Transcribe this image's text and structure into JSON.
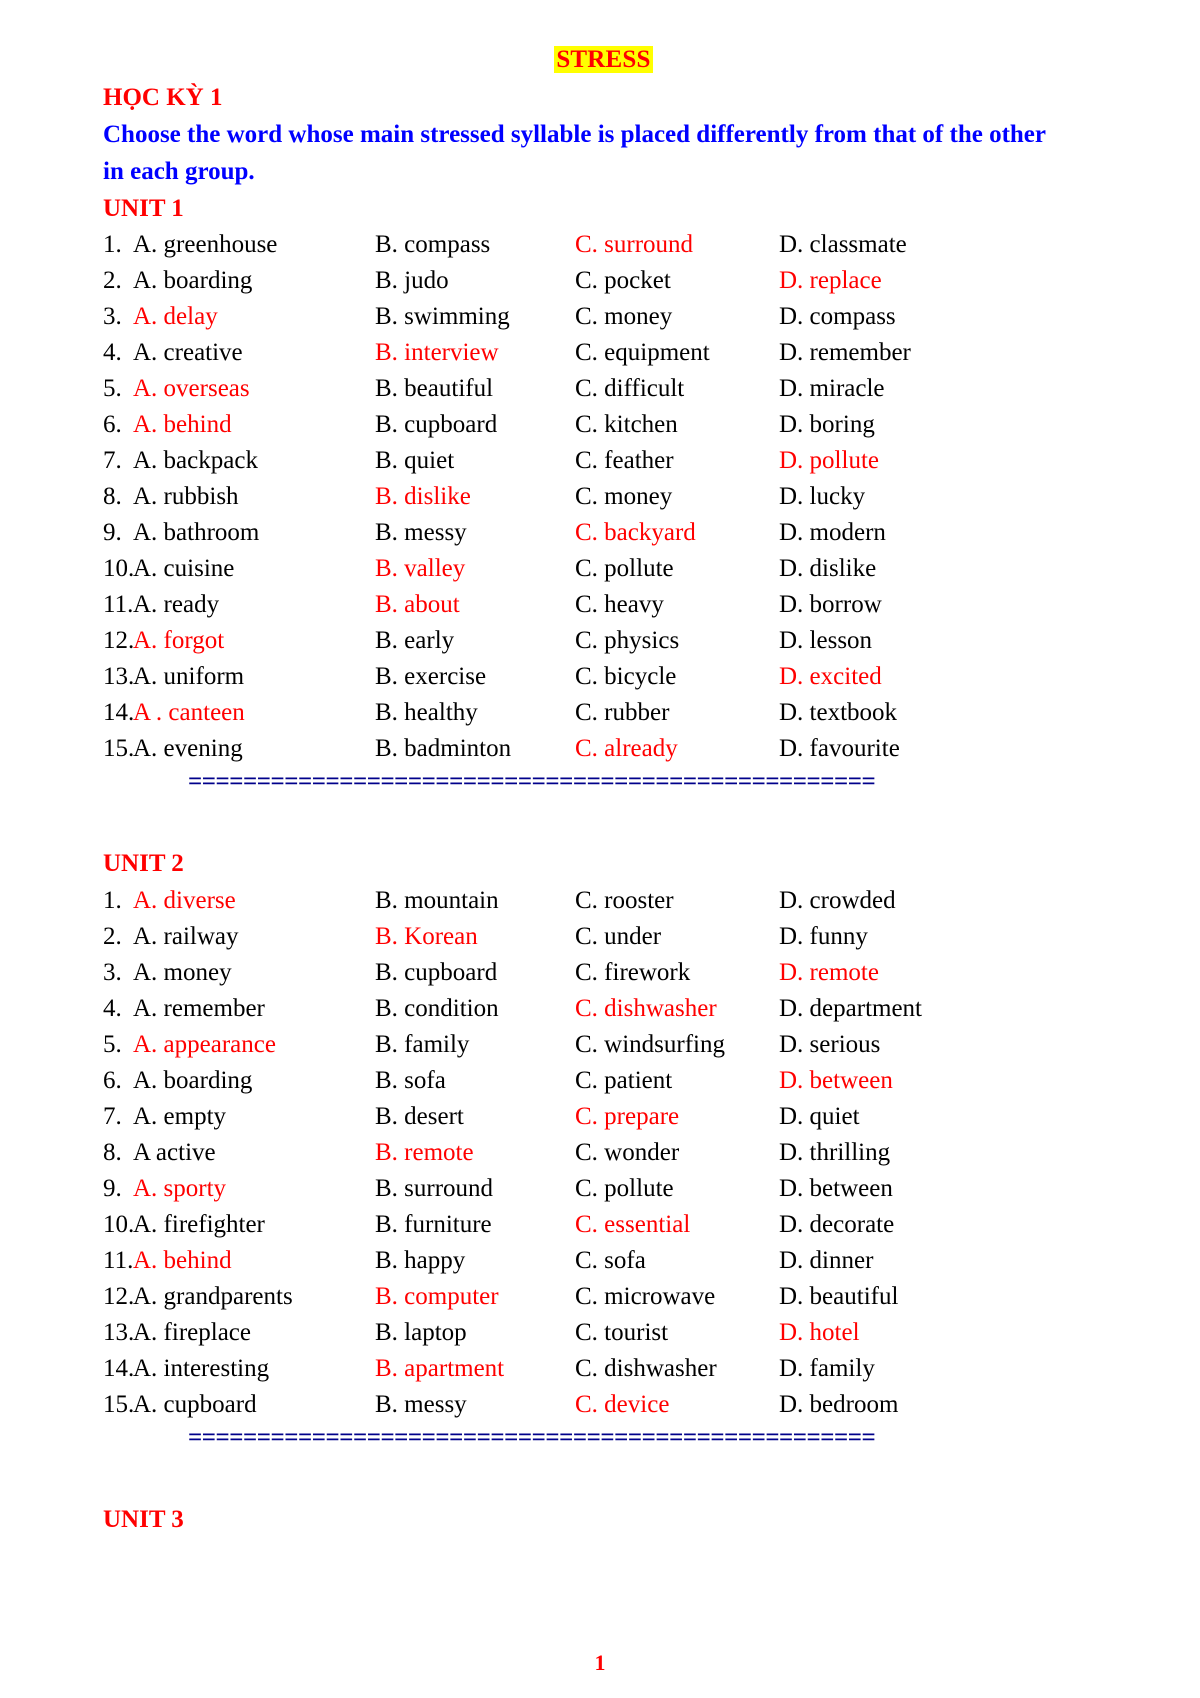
{
  "document": {
    "title": "STRESS",
    "title_highlight_color": "#ffff00",
    "title_text_color": "#ff0000",
    "term_heading": "HỌC KỲ 1",
    "instruction": "Choose the word whose main stressed syllable is placed differently from that of the other in each group.",
    "heading_color": "#ff0000",
    "instruction_color": "#0000ff",
    "answer_color": "#ff0000",
    "separator_color": "#00008b",
    "separator": "==================================================",
    "page_number": "1"
  },
  "units": [
    {
      "heading": "UNIT 1",
      "questions": [
        {
          "num": "1.",
          "a": "A. greenhouse",
          "b": "B. compass",
          "c": "C. surround",
          "d": "D. classmate",
          "answer": "c"
        },
        {
          "num": "2.",
          "a": "A. boarding",
          "b": "B. judo",
          "c": "C. pocket",
          "d": "D. replace",
          "answer": "d"
        },
        {
          "num": "3.",
          "a": "A. delay",
          "b": "B. swimming",
          "c": "C. money",
          "d": "D. compass",
          "answer": "a"
        },
        {
          "num": "4.",
          "a": "A. creative",
          "b": "B. interview",
          "c": "C. equipment",
          "d": "D. remember",
          "answer": "b"
        },
        {
          "num": "5.",
          "a": "A. overseas",
          "b": "B. beautiful",
          "c": "C. difficult",
          "d": "D. miracle",
          "answer": "a"
        },
        {
          "num": "6.",
          "a": "A. behind",
          "b": "B. cupboard",
          "c": "C. kitchen",
          "d": "D. boring",
          "answer": "a"
        },
        {
          "num": "7.",
          "a": "A. backpack",
          "b": "B. quiet",
          "c": "C. feather",
          "d": "D. pollute",
          "answer": "d"
        },
        {
          "num": "8.",
          "a": "A. rubbish",
          "b": "B. dislike",
          "c": "C. money",
          "d": "D. lucky",
          "answer": "b"
        },
        {
          "num": "9.",
          "a": "A. bathroom",
          "b": "B. messy",
          "c": "C. backyard",
          "d": "D. modern",
          "answer": "c"
        },
        {
          "num": "10.",
          "a": "A. cuisine",
          "b": "B. valley",
          "c": "C. pollute",
          "d": "D. dislike",
          "answer": "b"
        },
        {
          "num": "11.",
          "a": "A. ready",
          "b": "B. about",
          "c": "C. heavy",
          "d": "D. borrow",
          "answer": "b"
        },
        {
          "num": "12.",
          "a": "A. forgot",
          "b": "B. early",
          "c": "C. physics",
          "d": "D. lesson",
          "answer": "a"
        },
        {
          "num": "13.",
          "a": "A. uniform",
          "b": "B. exercise",
          "c": "C. bicycle",
          "d": "D. excited",
          "answer": "d"
        },
        {
          "num": "14.",
          "a": "A . canteen",
          "b": "B. healthy",
          "c": "C. rubber",
          "d": "D. textbook",
          "answer": "a"
        },
        {
          "num": "15.",
          "a": "A. evening",
          "b": "B. badminton",
          "c": "C. already",
          "d": "D. favourite",
          "answer": "c"
        }
      ]
    },
    {
      "heading": "UNIT 2",
      "questions": [
        {
          "num": "1.",
          "a": "A. diverse",
          "b": "B. mountain",
          "c": "C. rooster",
          "d": "D. crowded",
          "answer": "a"
        },
        {
          "num": "2.",
          "a": "A. railway",
          "b": "B. Korean",
          "c": "C. under",
          "d": "D. funny",
          "answer": "b"
        },
        {
          "num": "3.",
          "a": "A. money",
          "b": "B. cupboard",
          "c": "C. firework",
          "d": "D. remote",
          "answer": "d"
        },
        {
          "num": "4.",
          "a": "A. remember",
          "b": "B. condition",
          "c": "C. dishwasher",
          "d": "D. department",
          "answer": "c"
        },
        {
          "num": "5.",
          "a": "A. appearance",
          "b": "B. family",
          "c": "C. windsurfing",
          "d": "D. serious",
          "answer": "a"
        },
        {
          "num": "6.",
          "a": "A. boarding",
          "b": "B. sofa",
          "c": "C. patient",
          "d": "D. between",
          "answer": "d"
        },
        {
          "num": "7.",
          "a": "A. empty",
          "b": "B. desert",
          "c": "C. prepare",
          "d": "D. quiet",
          "answer": "c"
        },
        {
          "num": "8.",
          "a": "A active",
          "b": "B. remote",
          "c": "C. wonder",
          "d": "D. thrilling",
          "answer": "b"
        },
        {
          "num": "9.",
          "a": "A. sporty",
          "b": "B. surround",
          "c": "C. pollute",
          "d": "D. between",
          "answer": "a"
        },
        {
          "num": "10.",
          "a": "A. firefighter",
          "b": "B. furniture",
          "c": "C. essential",
          "d": "D. decorate",
          "answer": "c"
        },
        {
          "num": "11.",
          "a": "A. behind",
          "b": "B. happy",
          "c": "C. sofa",
          "d": "D. dinner",
          "answer": "a"
        },
        {
          "num": "12.",
          "a": "A. grandparents",
          "b": "B. computer",
          "c": "C. microwave",
          "d": "D. beautiful",
          "answer": "b"
        },
        {
          "num": "13.",
          "a": "A. fireplace",
          "b": "B. laptop",
          "c": "C. tourist",
          "d": "D. hotel",
          "answer": "d"
        },
        {
          "num": "14.",
          "a": "A. interesting",
          "b": "B. apartment",
          "c": "C. dishwasher",
          "d": "D. family",
          "answer": "b"
        },
        {
          "num": "15.",
          "a": "A. cupboard",
          "b": "B. messy",
          "c": "C. device",
          "d": "D. bedroom",
          "answer": "c"
        }
      ]
    },
    {
      "heading": "UNIT 3",
      "questions": []
    }
  ]
}
